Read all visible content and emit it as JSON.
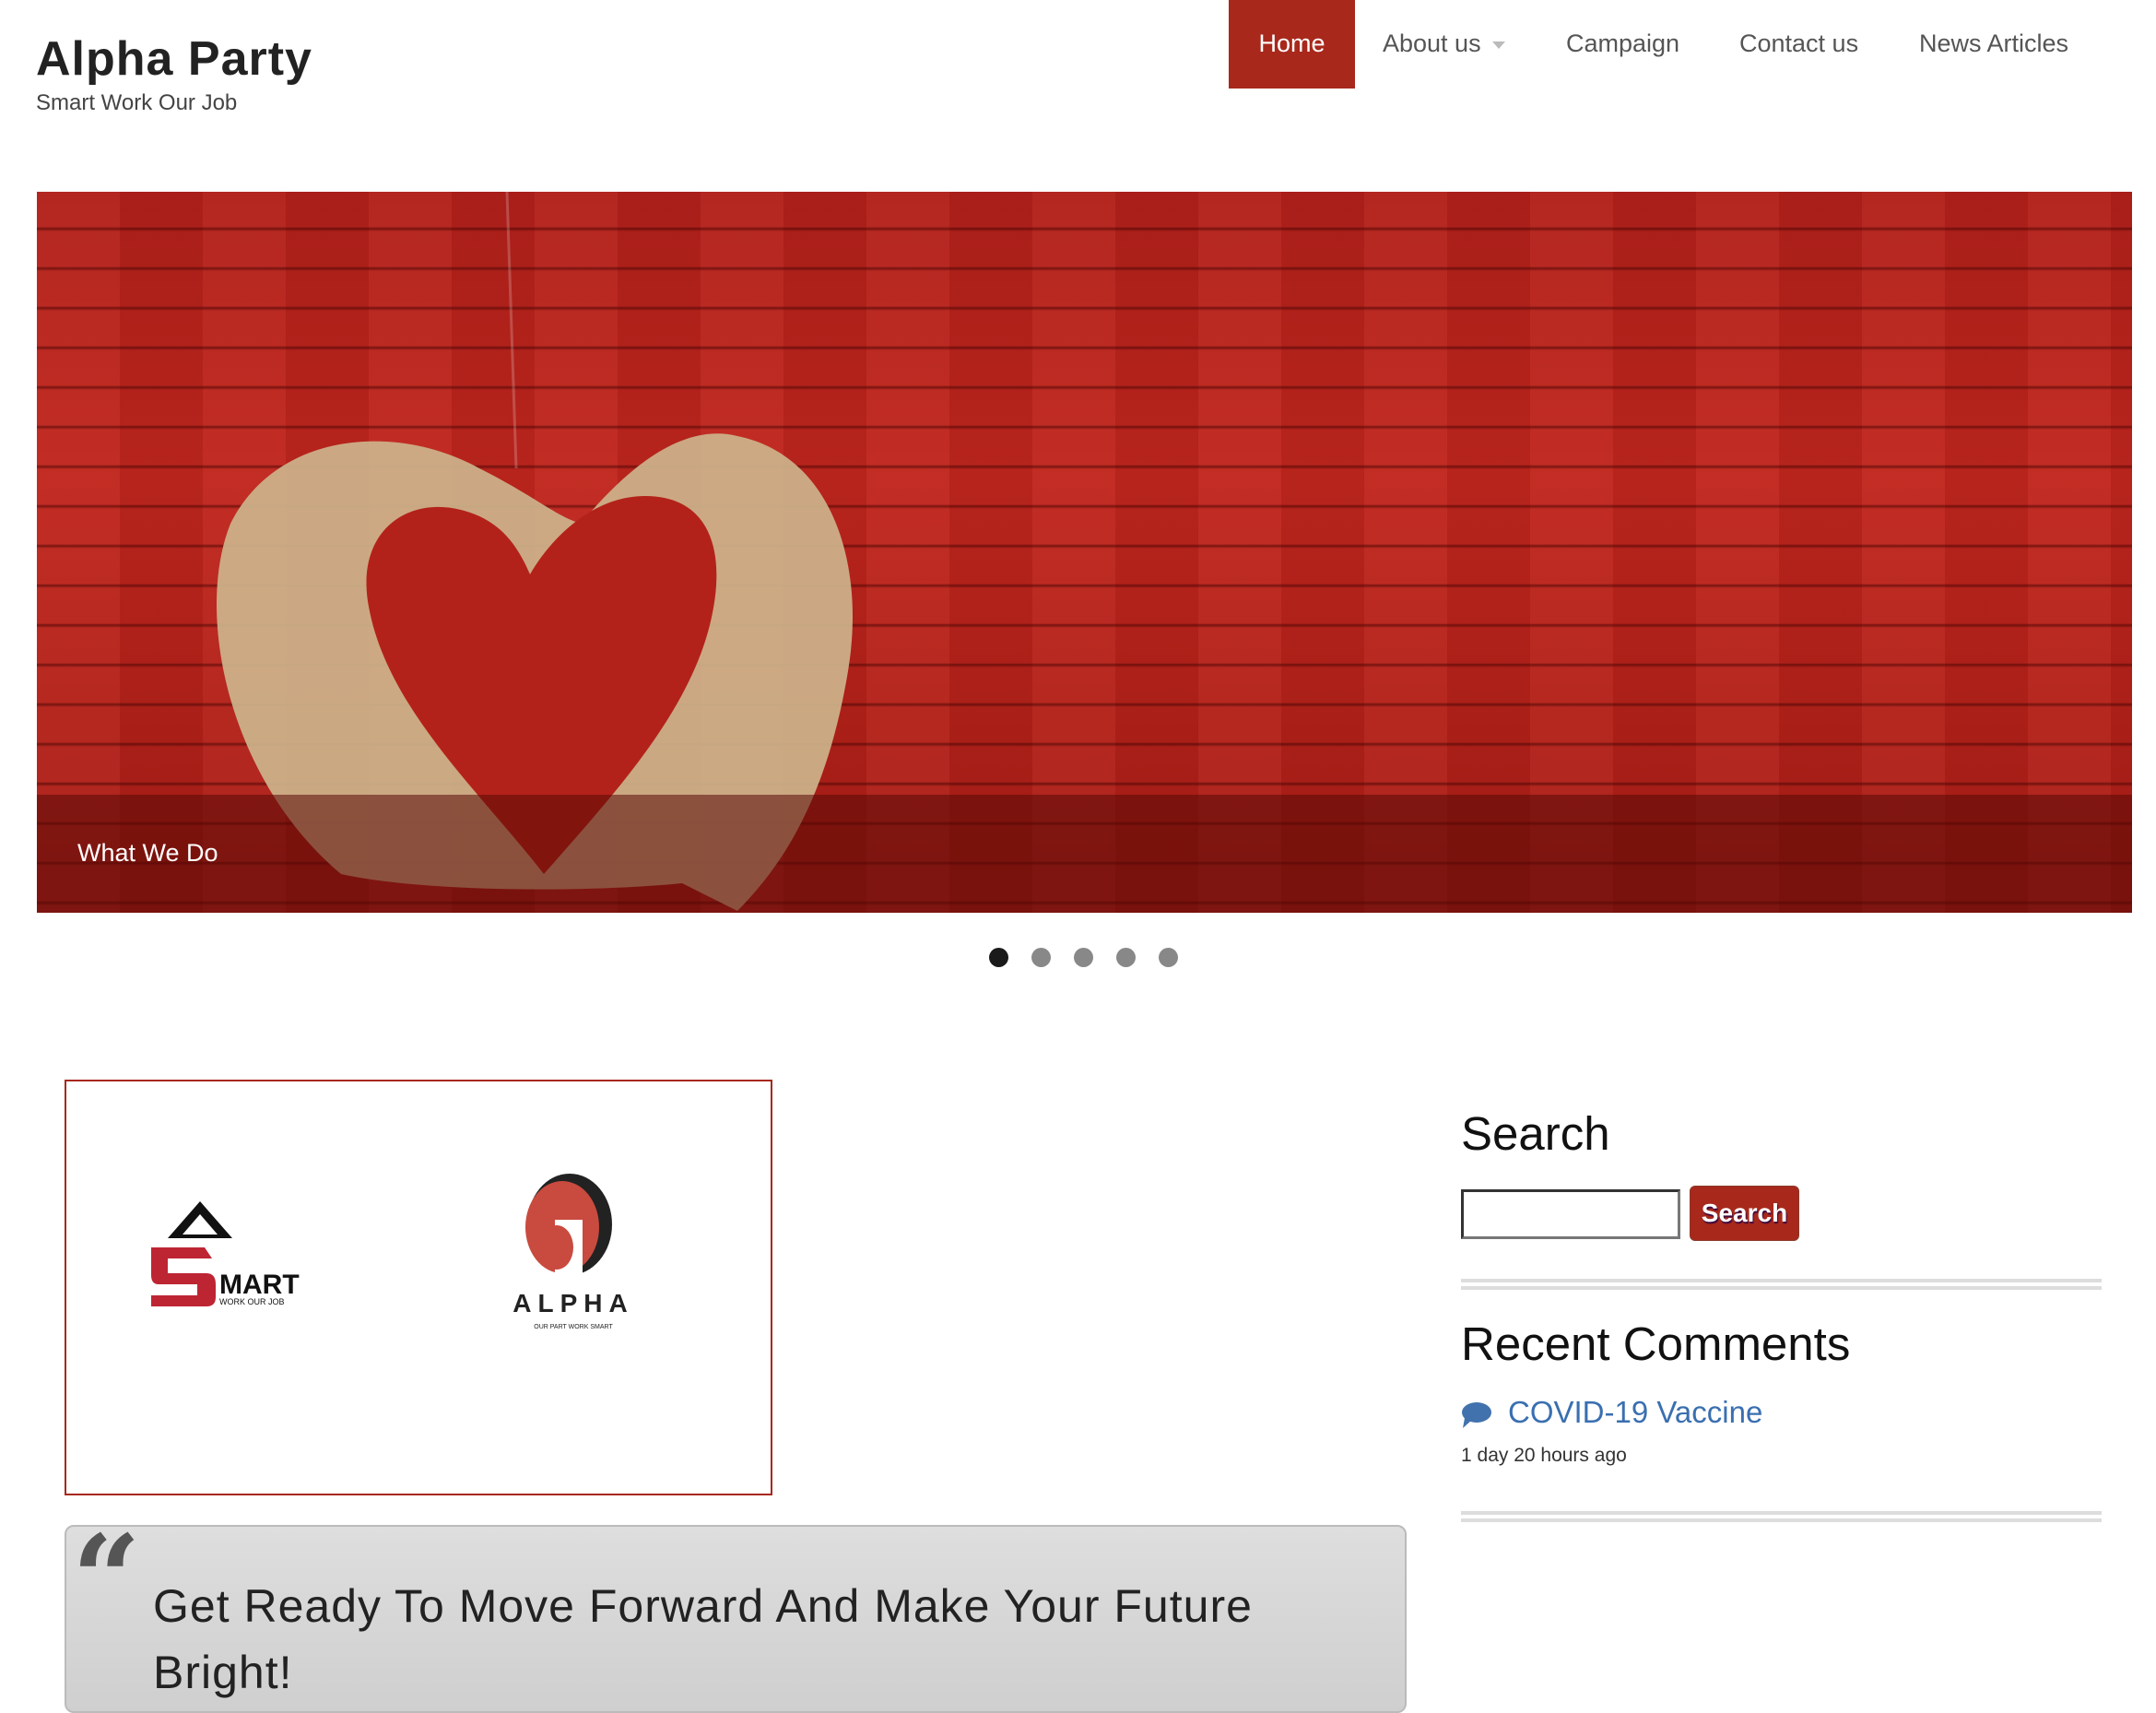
{
  "site": {
    "title": "Alpha Party",
    "slogan": "Smart Work Our Job"
  },
  "nav": {
    "items": [
      {
        "label": "Home",
        "active": true
      },
      {
        "label": "About us",
        "has_dropdown": true
      },
      {
        "label": "Campaign"
      },
      {
        "label": "Contact us"
      },
      {
        "label": "News Articles"
      }
    ]
  },
  "slider": {
    "caption": "What We Do",
    "slide_count": 5,
    "active_slide": 1
  },
  "logos": {
    "smart": {
      "word": "MART",
      "tagline": "WORK OUR JOB"
    },
    "alpha": {
      "word": "ALPHA",
      "tagline": "OUR PART WORK SMART"
    }
  },
  "quote": {
    "text": "Get Ready To Move Forward And Make Your Future Bright!"
  },
  "sidebar": {
    "search": {
      "title": "Search",
      "input_value": "",
      "button_label": "Search"
    },
    "recent_comments": {
      "title": "Recent Comments",
      "items": [
        {
          "link": "COVID-19 Vaccine",
          "time": "1 day 20 hours ago"
        }
      ]
    }
  },
  "colors": {
    "brand": "#a8281c",
    "link": "#3a6fb0"
  }
}
